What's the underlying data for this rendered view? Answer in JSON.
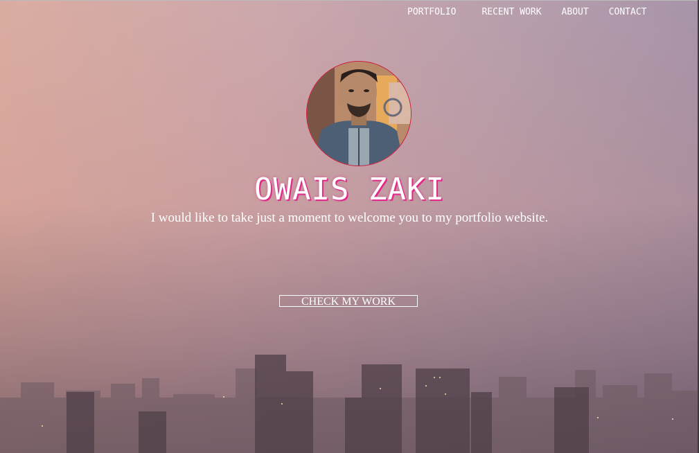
{
  "nav": {
    "items": [
      {
        "label": "PORTFOLIO"
      },
      {
        "label": "RECENT WORK"
      },
      {
        "label": "ABOUT"
      },
      {
        "label": "CONTACT"
      }
    ]
  },
  "hero": {
    "name": "OWAIS ZAKI",
    "tagline": "I would like to take just a moment to welcome you to my portfolio website.",
    "cta_label": "CHECK MY WORK"
  },
  "colors": {
    "accent": "#e2288a",
    "avatar_border": "#d2183c",
    "text": "#ffffff"
  }
}
